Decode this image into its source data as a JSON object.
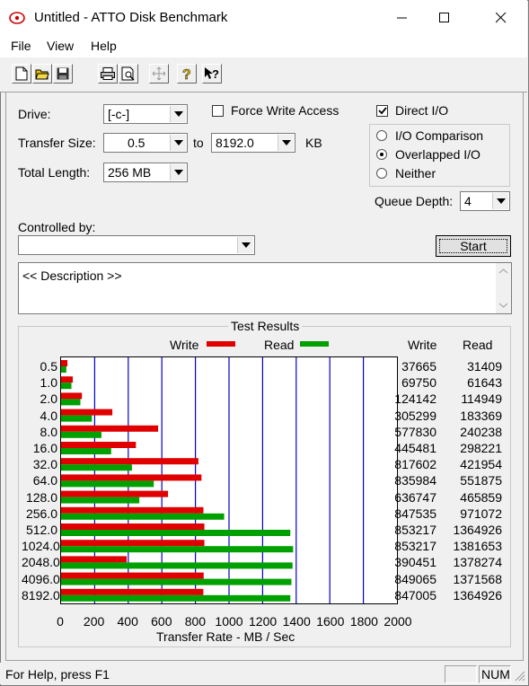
{
  "window": {
    "title": "Untitled - ATTO Disk Benchmark",
    "minimize_glyph": "—",
    "maximize_glyph": "☐",
    "close_glyph": "✕"
  },
  "menu": [
    {
      "label": "File"
    },
    {
      "label": "View"
    },
    {
      "label": "Help"
    }
  ],
  "toolbar_icons": [
    "new-file-icon",
    "open-folder-icon",
    "save-icon",
    "print-icon",
    "print-preview-icon",
    "move-icon",
    "help-icon",
    "context-help-icon"
  ],
  "form": {
    "drive_label": "Drive:",
    "drive_value": "[-c-]",
    "force_write_label": "Force Write Access",
    "force_write_checked": false,
    "direct_io_label": "Direct I/O",
    "direct_io_checked": true,
    "transfer_size_label": "Transfer Size:",
    "transfer_from": "0.5",
    "to_label": "to",
    "transfer_to": "8192.0",
    "kb_label": "KB",
    "total_length_label": "Total Length:",
    "total_length_value": "256 MB",
    "io_options": [
      {
        "label": "I/O Comparison",
        "selected": false
      },
      {
        "label": "Overlapped I/O",
        "selected": true
      },
      {
        "label": "Neither",
        "selected": false
      }
    ],
    "queue_depth_label": "Queue Depth:",
    "queue_depth_value": "4",
    "controlled_by_label": "Controlled by:",
    "controlled_by_value": "",
    "start_label": "Start",
    "description": "<< Description >>"
  },
  "results": {
    "title": "Test Results",
    "write_legend": "Write",
    "read_legend": "Read",
    "write_col": "Write",
    "read_col": "Read",
    "x_axis_label": "Transfer Rate - MB / Sec"
  },
  "chart_data": {
    "type": "bar",
    "orientation": "horizontal",
    "title": "Test Results",
    "xlabel": "Transfer Rate - MB / Sec",
    "xlim": [
      0,
      2000
    ],
    "xticks": [
      "0",
      "200",
      "400",
      "600",
      "800",
      "1000",
      "1200",
      "1400",
      "1600",
      "1800",
      "2000"
    ],
    "categories": [
      "0.5",
      "1.0",
      "2.0",
      "4.0",
      "8.0",
      "16.0",
      "32.0",
      "64.0",
      "128.0",
      "256.0",
      "512.0",
      "1024.0",
      "2048.0",
      "4096.0",
      "8192.0"
    ],
    "series": [
      {
        "name": "Write",
        "color": "#e00000",
        "values": [
          37665,
          69750,
          124142,
          305299,
          577830,
          445481,
          817602,
          835984,
          636747,
          847535,
          853217,
          853217,
          390451,
          849065,
          847005
        ]
      },
      {
        "name": "Read",
        "color": "#00a000",
        "values": [
          31409,
          61643,
          114949,
          183369,
          240238,
          298221,
          421954,
          551875,
          465859,
          971072,
          1364926,
          1381653,
          1378274,
          1371568,
          1364926
        ]
      }
    ],
    "units_note": "values shown are KB/s; bars scaled to MB/s axis",
    "grid": true,
    "legend_position": "top"
  },
  "status": {
    "help_text": "For Help, press F1",
    "num_indicator": "NUM"
  }
}
